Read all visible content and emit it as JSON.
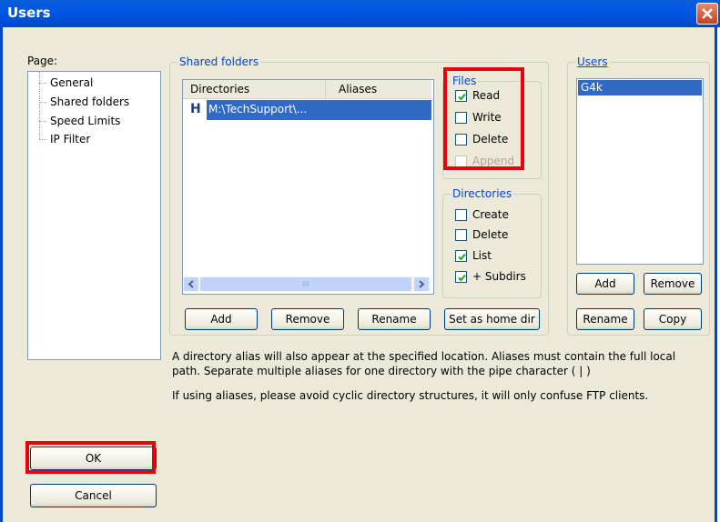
{
  "window": {
    "title": "Users"
  },
  "page": {
    "label": "Page:",
    "items": [
      "General",
      "Shared folders",
      "Speed Limits",
      "IP Filter"
    ]
  },
  "shared": {
    "title": "Shared folders",
    "columns": [
      "Directories",
      "Aliases"
    ],
    "rows": [
      {
        "marker": "H",
        "path": "M:\\TechSupport\\..."
      }
    ],
    "buttons": {
      "add": "Add",
      "remove": "Remove",
      "rename": "Rename",
      "home": "Set as home dir"
    }
  },
  "files": {
    "title": "Files",
    "read": "Read",
    "write": "Write",
    "delete": "Delete",
    "append": "Append",
    "read_checked": true,
    "write_checked": false,
    "delete_checked": false,
    "append_checked": false
  },
  "dirs": {
    "title": "Directories",
    "create": "Create",
    "delete": "Delete",
    "list": "List",
    "subdirs": "+ Subdirs",
    "create_checked": false,
    "delete_checked": false,
    "list_checked": true,
    "subdirs_checked": true
  },
  "users": {
    "title": "Users",
    "list": [
      "G4k"
    ],
    "buttons": {
      "add": "Add",
      "remove": "Remove",
      "rename": "Rename",
      "copy": "Copy"
    }
  },
  "info": {
    "line1": "A directory alias will also appear at the specified location. Aliases must contain the full local",
    "line2": "path. Separate multiple aliases for one directory with the pipe character ( | )",
    "line3": "If using aliases, please avoid cyclic directory structures, it will only confuse FTP clients."
  },
  "buttons": {
    "ok": "OK",
    "cancel": "Cancel"
  },
  "colors": {
    "highlight": "#e8000b",
    "selection": "#316ac5",
    "title_bar": "#0058e6"
  },
  "scrollbar": {
    "thumb_glyph": "III"
  }
}
